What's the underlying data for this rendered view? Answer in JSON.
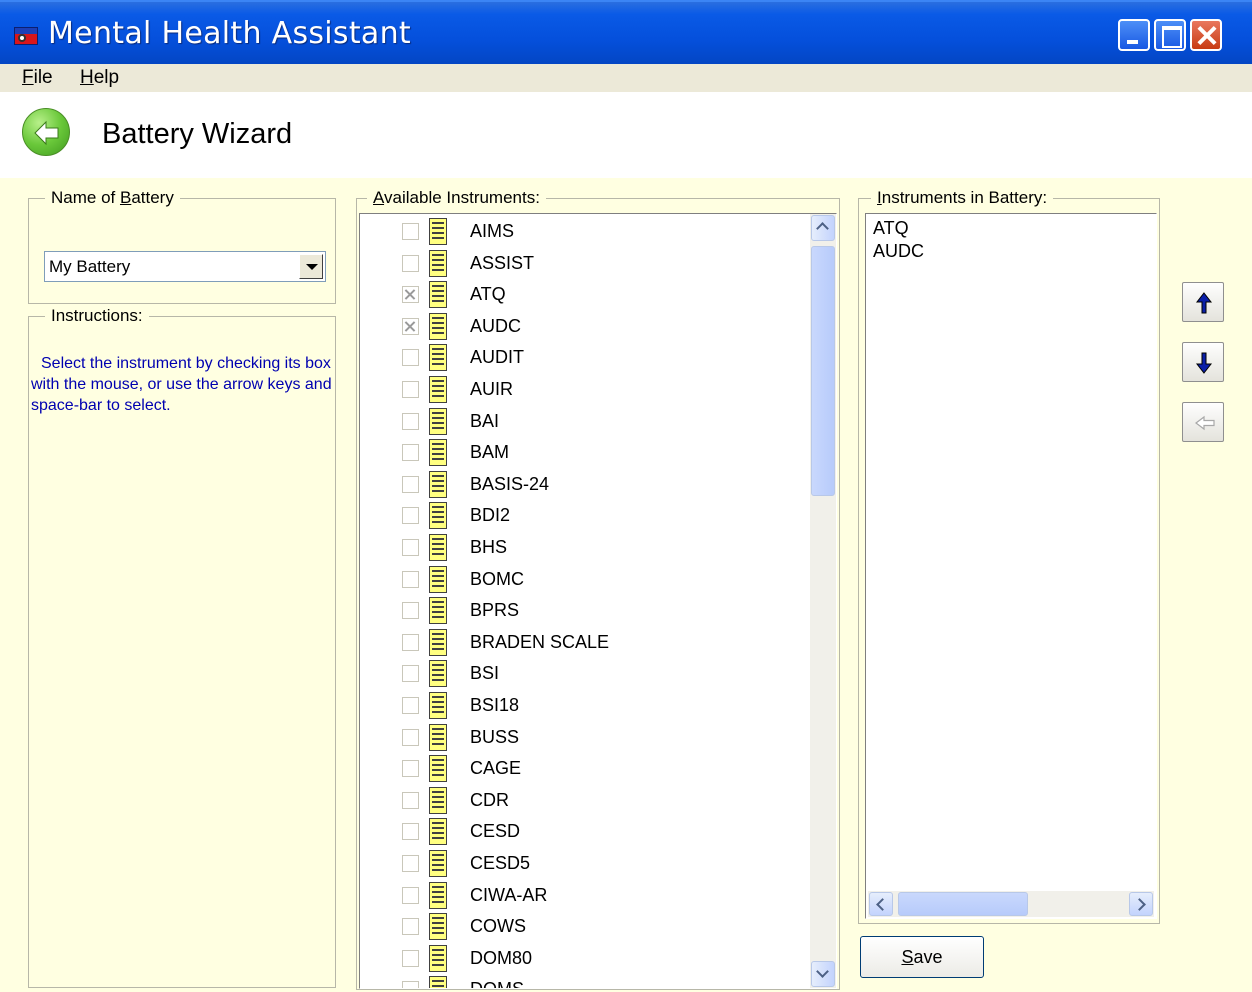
{
  "window": {
    "title": "Mental Health Assistant"
  },
  "menu": {
    "file_pre": "",
    "file_key": "F",
    "file_rest": "ile",
    "help_pre": "",
    "help_key": "H",
    "help_rest": "elp"
  },
  "header": {
    "title": "Battery Wizard"
  },
  "battery_name": {
    "label_pre": "Name of ",
    "label_key": "B",
    "label_rest": "attery",
    "selected": "My Battery"
  },
  "instructions": {
    "label": "Instructions:",
    "text": "Select the instrument by checking its box with the mouse, or use the arrow keys and space-bar to select."
  },
  "available": {
    "label_pre": "",
    "label_key": "A",
    "label_rest": "vailable Instruments:",
    "items": [
      {
        "name": "AIMS",
        "checked": false
      },
      {
        "name": "ASSIST",
        "checked": false
      },
      {
        "name": "ATQ",
        "checked": true
      },
      {
        "name": "AUDC",
        "checked": true
      },
      {
        "name": "AUDIT",
        "checked": false
      },
      {
        "name": "AUIR",
        "checked": false
      },
      {
        "name": "BAI",
        "checked": false
      },
      {
        "name": "BAM",
        "checked": false
      },
      {
        "name": "BASIS-24",
        "checked": false
      },
      {
        "name": "BDI2",
        "checked": false
      },
      {
        "name": "BHS",
        "checked": false
      },
      {
        "name": "BOMC",
        "checked": false
      },
      {
        "name": "BPRS",
        "checked": false
      },
      {
        "name": "BRADEN SCALE",
        "checked": false
      },
      {
        "name": "BSI",
        "checked": false
      },
      {
        "name": "BSI18",
        "checked": false
      },
      {
        "name": "BUSS",
        "checked": false
      },
      {
        "name": "CAGE",
        "checked": false
      },
      {
        "name": "CDR",
        "checked": false
      },
      {
        "name": "CESD",
        "checked": false
      },
      {
        "name": "CESD5",
        "checked": false
      },
      {
        "name": "CIWA-AR",
        "checked": false
      },
      {
        "name": "COWS",
        "checked": false
      },
      {
        "name": "DOM80",
        "checked": false
      },
      {
        "name": "DOMS",
        "checked": false
      }
    ]
  },
  "in_battery": {
    "label_pre": "",
    "label_key": "I",
    "label_rest": "nstruments in Battery:",
    "items": [
      "ATQ",
      "AUDC"
    ]
  },
  "save": {
    "label_key": "S",
    "label_rest": "ave"
  },
  "colors": {
    "panel": "#ffffe1",
    "instructions_text": "#0000b0",
    "titlebar": "#0550dc"
  },
  "icons": [
    "back-arrow-icon",
    "move-up-icon",
    "move-down-icon",
    "remove-icon",
    "instrument-document-icon"
  ]
}
